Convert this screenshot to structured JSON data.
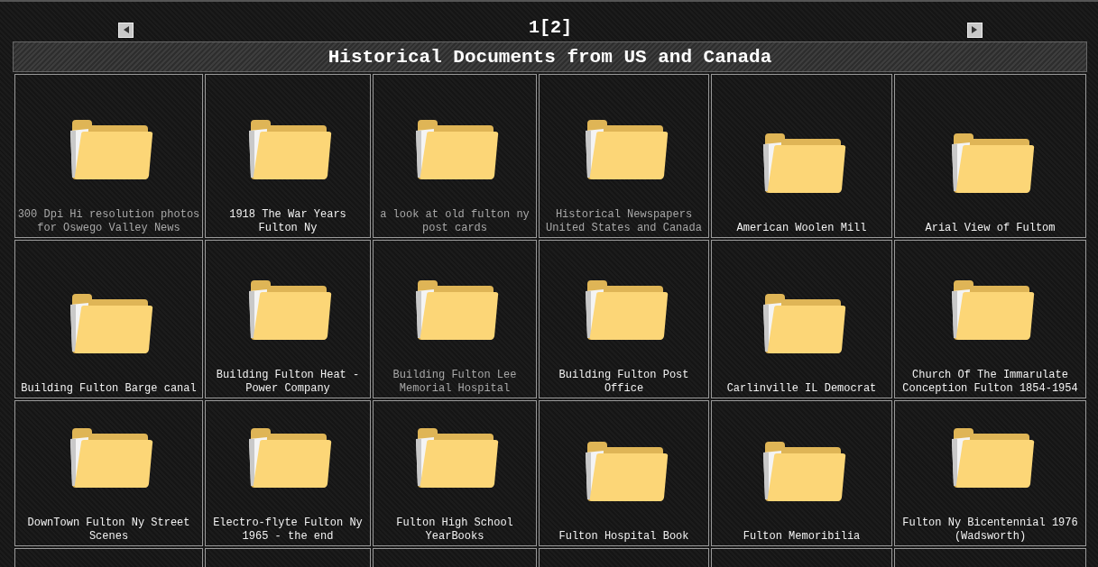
{
  "pager": {
    "label": "1[2]"
  },
  "title": "Historical Documents from US and Canada",
  "folders": [
    {
      "label": "300 Dpi Hi resolution photos for Oswego Valley News",
      "visited": true
    },
    {
      "label": "1918 The War Years Fulton Ny",
      "visited": false
    },
    {
      "label": "a look at old fulton ny post cards",
      "visited": true
    },
    {
      "label": "Historical Newspapers United States and Canada",
      "visited": true
    },
    {
      "label": "American Woolen Mill",
      "visited": false
    },
    {
      "label": "Arial View of Fultom",
      "visited": false
    },
    {
      "label": "Building Fulton Barge canal",
      "visited": false
    },
    {
      "label": "Building Fulton Heat - Power Company",
      "visited": false
    },
    {
      "label": "Building Fulton Lee Memorial Hospital",
      "visited": true
    },
    {
      "label": "Building Fulton Post Office",
      "visited": false
    },
    {
      "label": "Carlinville IL Democrat",
      "visited": false
    },
    {
      "label": "Church Of The Immarulate Conception Fulton 1854-1954",
      "visited": false
    },
    {
      "label": "DownTown Fulton Ny Street Scenes",
      "visited": false
    },
    {
      "label": "Electro-flyte Fulton Ny 1965 - the end",
      "visited": false
    },
    {
      "label": "Fulton High School YearBooks",
      "visited": false
    },
    {
      "label": "Fulton Hospital Book",
      "visited": false
    },
    {
      "label": "Fulton Memoribilia",
      "visited": false
    },
    {
      "label": "Fulton Ny Bicentennial 1976 (Wadsworth)",
      "visited": false
    }
  ]
}
